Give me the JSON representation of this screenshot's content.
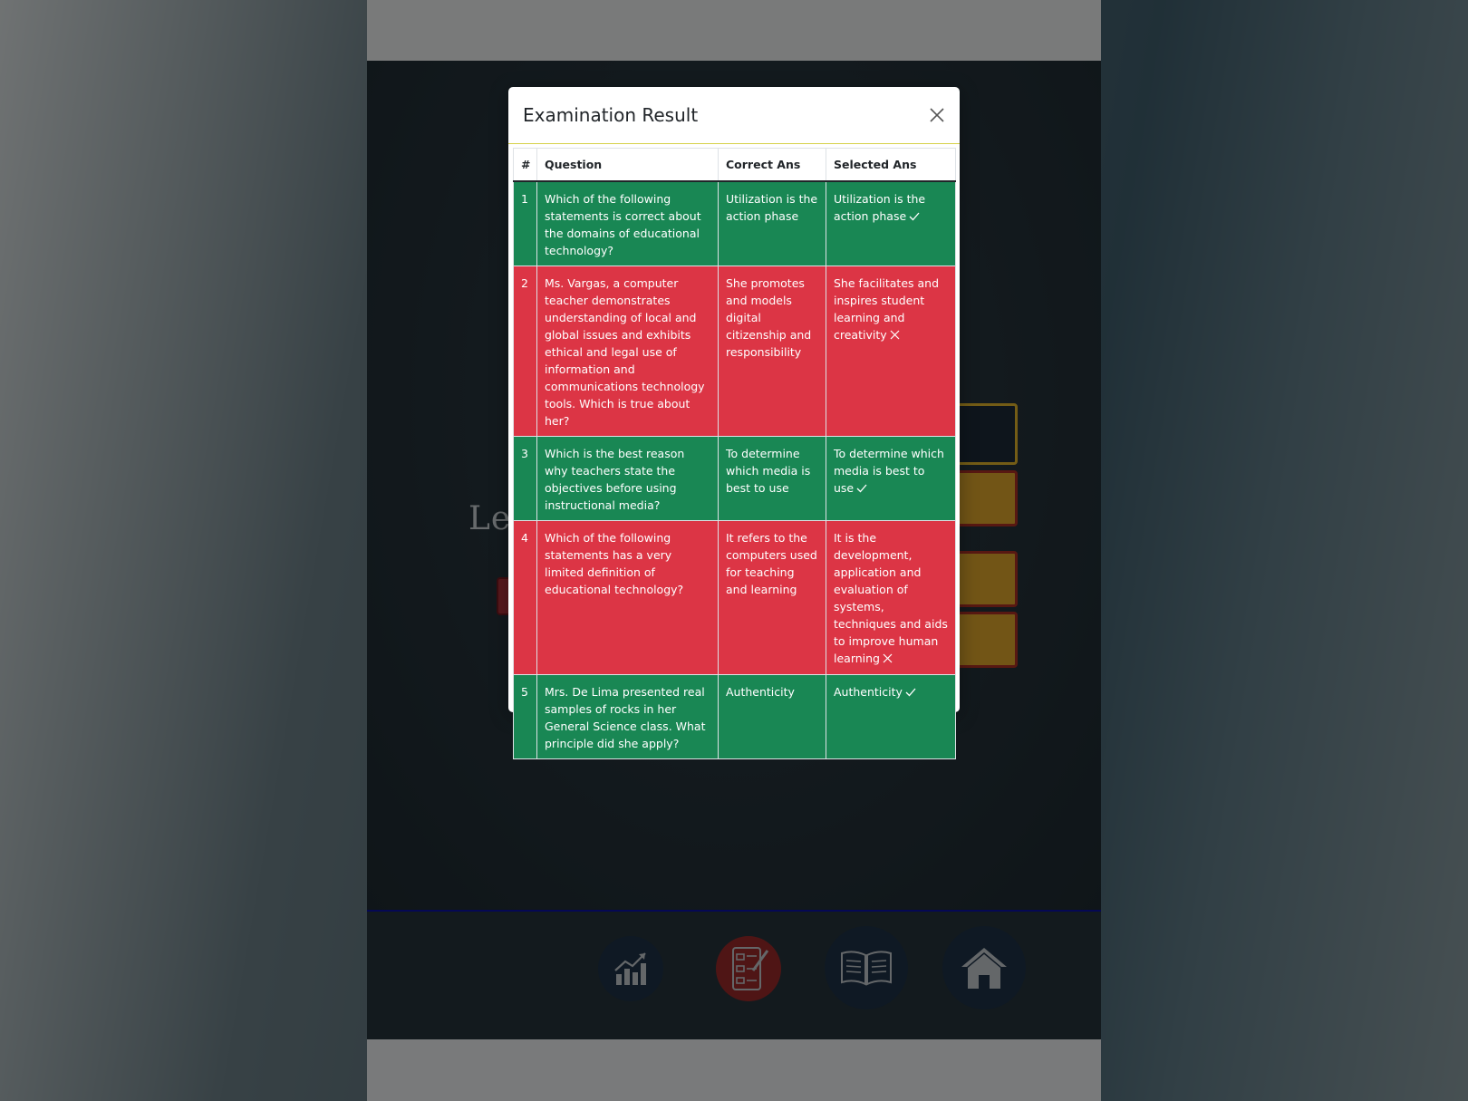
{
  "modal": {
    "title": "Examination Result",
    "close_icon": "close-icon",
    "columns": [
      "#",
      "Question",
      "Correct Ans",
      "Selected Ans"
    ],
    "rows": [
      {
        "num": "1",
        "question": "Which of the following statements is correct about the domains of educational technology?",
        "correct": "Utilization is the action phase",
        "selected": "Utilization is the action phase",
        "status": "correct"
      },
      {
        "num": "2",
        "question": "Ms. Vargas, a computer teacher demonstrates understanding of local and global issues and exhibits ethical and legal use of information and communications technology tools. Which is true about her?",
        "correct": "She promotes and models digital citizenship and responsibility",
        "selected": "She facilitates and inspires student learning and creativity",
        "status": "wrong"
      },
      {
        "num": "3",
        "question": "Which is the best reason why teachers state the objectives before using instructional media?",
        "correct": "To determine which media is best to use",
        "selected": "To determine which media is best to use",
        "status": "correct"
      },
      {
        "num": "4",
        "question": "Which of the following statements has a very limited definition of educational technology?",
        "correct": "It refers to the computers used for teaching and learning",
        "selected": "It is the development, application and evaluation of systems, techniques and aids to improve human learning",
        "status": "wrong"
      },
      {
        "num": "5",
        "question": "Mrs. De Lima presented real samples of rocks in her General Science class. What principle did she apply?",
        "correct": "Authenticity",
        "selected": "Authenticity",
        "status": "correct"
      }
    ]
  },
  "background": {
    "partial_word": "Le"
  },
  "nav": {
    "items": [
      "stats-chart-icon",
      "exam-icon",
      "book-icon",
      "home-icon"
    ]
  },
  "colors": {
    "correct": "#198754",
    "wrong": "#dc3545",
    "nav_accent": "#0b11a8"
  }
}
